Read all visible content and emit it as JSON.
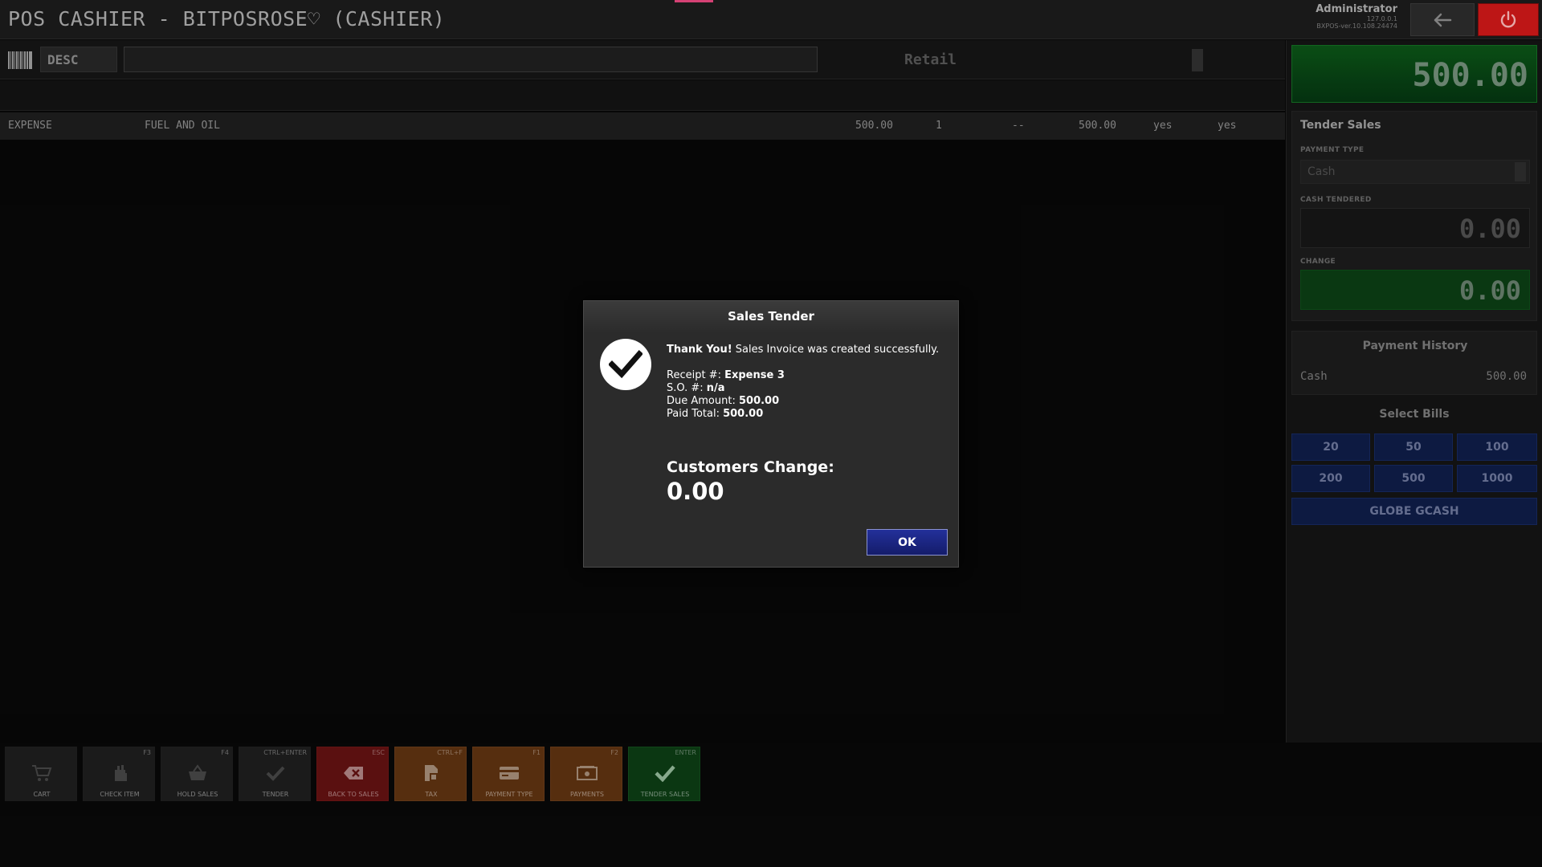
{
  "header": {
    "title": "POS CASHIER - BITPOSROSE♡ (CASHIER)",
    "user": "Administrator",
    "ip": "127.0.0.1",
    "host": "BXPOS-ver.10.108.24474"
  },
  "search": {
    "mode_label": "DESC",
    "value": "",
    "price_level": "Retail"
  },
  "item_row": {
    "type": "EXPENSE",
    "description": "FUEL AND OIL",
    "price": "500.00",
    "qty": "1",
    "discount": "--",
    "amount": "500.00",
    "flag1": "yes",
    "flag2": "yes"
  },
  "panel": {
    "total": "500.00",
    "tender_title": "Tender Sales",
    "payment_type_label": "PAYMENT TYPE",
    "payment_type_value": "Cash",
    "cash_tendered_label": "CASH TENDERED",
    "cash_tendered_value": "0.00",
    "change_label": "CHANGE",
    "change_value": "0.00",
    "history_title": "Payment History",
    "history": [
      {
        "method": "Cash",
        "amount": "500.00"
      }
    ],
    "bills_title": "Select Bills",
    "bills": [
      "20",
      "50",
      "100",
      "200",
      "500",
      "1000"
    ],
    "gcash_label": "GLOBE GCASH"
  },
  "toolbar": [
    {
      "label": "CART",
      "key": "",
      "style": "gray",
      "icon": "cart-icon"
    },
    {
      "label": "CHECK ITEM",
      "key": "F3",
      "style": "gray",
      "icon": "hand-icon"
    },
    {
      "label": "HOLD SALES",
      "key": "F4",
      "style": "gray",
      "icon": "basket-icon"
    },
    {
      "label": "TENDER",
      "key": "CTRL+ENTER",
      "style": "gray",
      "icon": "check-icon"
    },
    {
      "label": "BACK TO SALES",
      "key": "ESC",
      "style": "red",
      "icon": "backspace-icon"
    },
    {
      "label": "TAX",
      "key": "CTRL+F",
      "style": "orange",
      "icon": "document-icon"
    },
    {
      "label": "PAYMENT TYPE",
      "key": "F1",
      "style": "orange",
      "icon": "card-icon"
    },
    {
      "label": "PAYMENTS",
      "key": "F2",
      "style": "orange",
      "icon": "cash-icon"
    },
    {
      "label": "TENDER SALES",
      "key": "ENTER",
      "style": "green",
      "icon": "check-icon"
    }
  ],
  "modal": {
    "title": "Sales Tender",
    "thanks": "Thank You!",
    "message": " Sales Invoice was created successfully.",
    "receipt_label": "Receipt #: ",
    "receipt_value": "Expense 3",
    "so_label": "S.O. #: ",
    "so_value": "n/a",
    "due_label": "Due Amount: ",
    "due_value": "500.00",
    "paid_label": "Paid Total: ",
    "paid_value": "500.00",
    "change_label": "Customers Change:",
    "change_value": "0.00",
    "ok_label": "OK"
  }
}
